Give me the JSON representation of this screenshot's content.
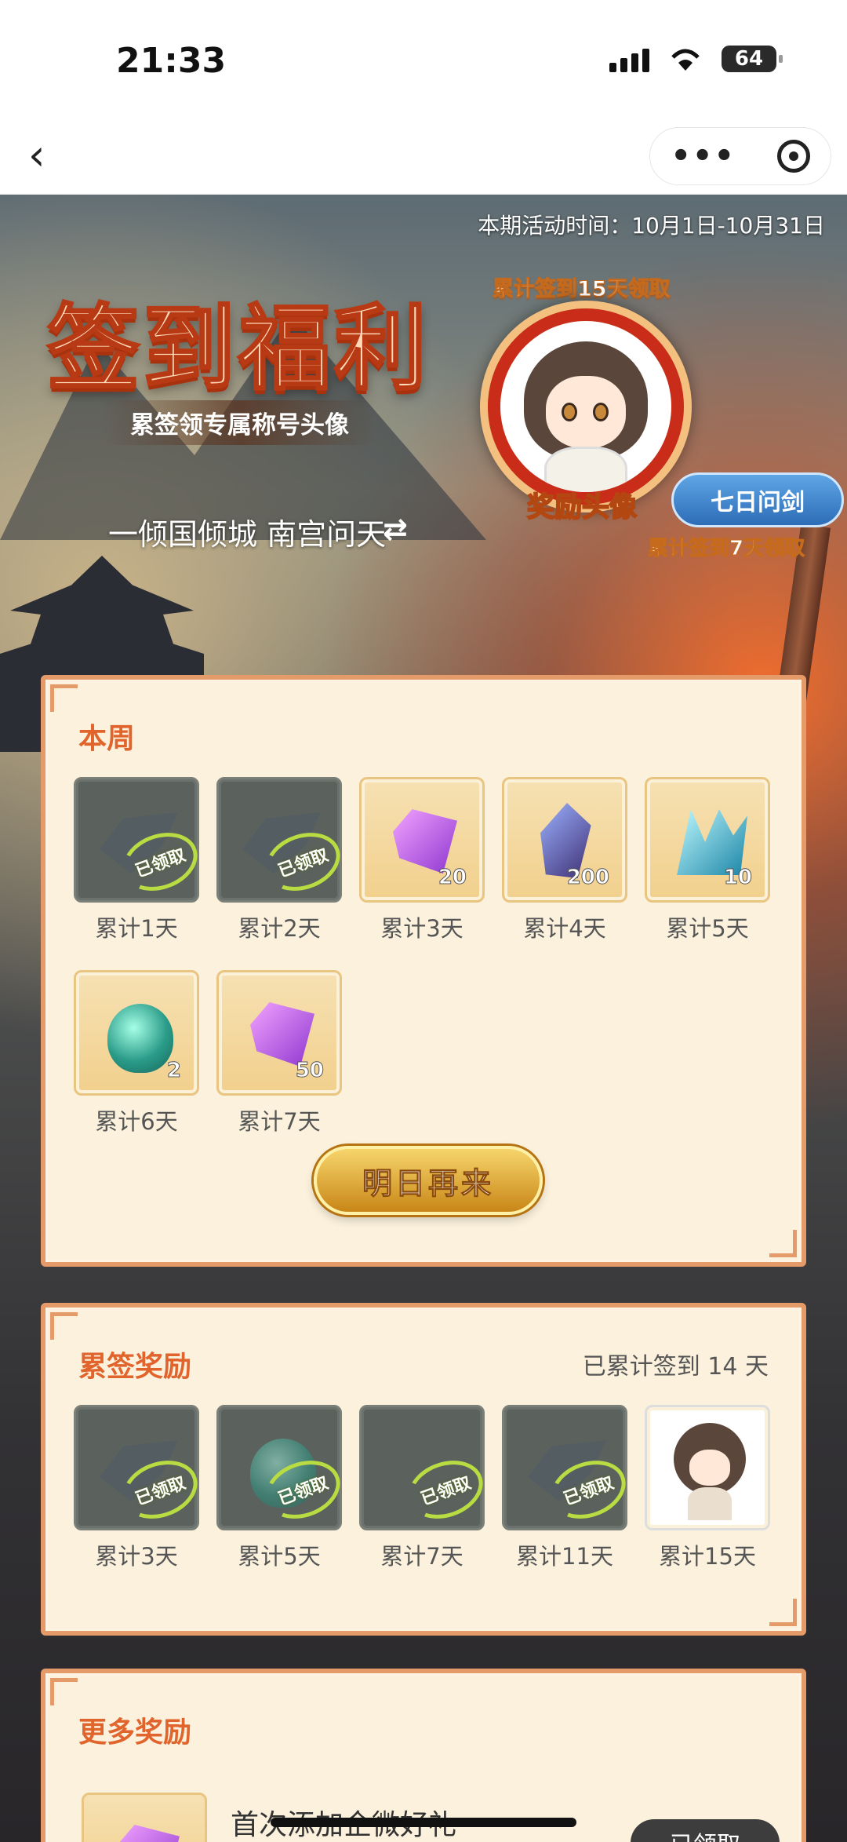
{
  "status_bar": {
    "time": "21:33",
    "battery": "64"
  },
  "nav": {
    "back_icon": "chevron-left",
    "more_icon": "ellipsis",
    "close_icon": "target"
  },
  "hero": {
    "period": "本期活动时间：10月1日-10月31日",
    "title": "签到福利",
    "subtitle": "累签领专属称号头像",
    "player_name": "一倾国倾城 南宫问天",
    "avatar_condition": "累计签到15天领取",
    "avatar_label": "奖励头像",
    "title_badge": "七日问剑",
    "title_condition": "累计签到7天领取"
  },
  "weekly": {
    "title": "本周",
    "items": [
      {
        "label": "累计1天",
        "claimed": true,
        "stamp": "已领取"
      },
      {
        "label": "累计2天",
        "claimed": true,
        "stamp": "已领取"
      },
      {
        "label": "累计3天",
        "qty": "20"
      },
      {
        "label": "累计4天",
        "qty": "200"
      },
      {
        "label": "累计5天",
        "qty": "10"
      },
      {
        "label": "累计6天",
        "qty": "2"
      },
      {
        "label": "累计7天",
        "qty": "50"
      }
    ],
    "button": "明日再来"
  },
  "cumulative": {
    "title": "累签奖励",
    "summary": "已累计签到 14 天",
    "items": [
      {
        "label": "累计3天",
        "stamp": "已领取"
      },
      {
        "label": "累计5天",
        "stamp": "已领取"
      },
      {
        "label": "累计7天",
        "stamp": "已领取"
      },
      {
        "label": "累计11天",
        "stamp": "已领取"
      },
      {
        "label": "累计15天"
      }
    ]
  },
  "more": {
    "title": "更多奖励",
    "item_text": "首次添加企微好礼",
    "button": "已领取"
  }
}
